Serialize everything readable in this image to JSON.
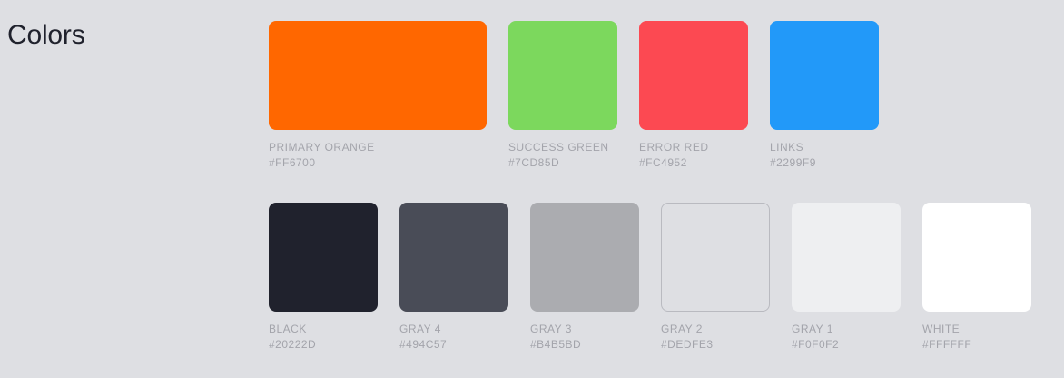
{
  "section": {
    "title": "Colors"
  },
  "row1": [
    {
      "name": "PRIMARY ORANGE",
      "hex": "#FF6700",
      "color": "#FF6700"
    },
    {
      "name": "SUCCESS GREEN",
      "hex": "#7CD85D",
      "color": "#7CD85D"
    },
    {
      "name": "ERROR RED",
      "hex": "#FC4952",
      "color": "#FC4952"
    },
    {
      "name": "LINKS",
      "hex": "#2299F9",
      "color": "#2299F9"
    }
  ],
  "row2": [
    {
      "name": "BLACK",
      "hex": "#20222D",
      "color": "#20222D"
    },
    {
      "name": "GRAY 4",
      "hex": "#494C57",
      "color": "#494C57"
    },
    {
      "name": "GRAY 3",
      "hex": "#B4B5BD",
      "color": "#ABACB0"
    },
    {
      "name": "GRAY 2",
      "hex": "#DEDFE3",
      "color": "#DEDFE3"
    },
    {
      "name": "GRAY 1",
      "hex": "#F0F0F2",
      "color": "#EEEFF1"
    },
    {
      "name": "WHITE",
      "hex": "#FFFFFF",
      "color": "#FFFFFF"
    }
  ]
}
